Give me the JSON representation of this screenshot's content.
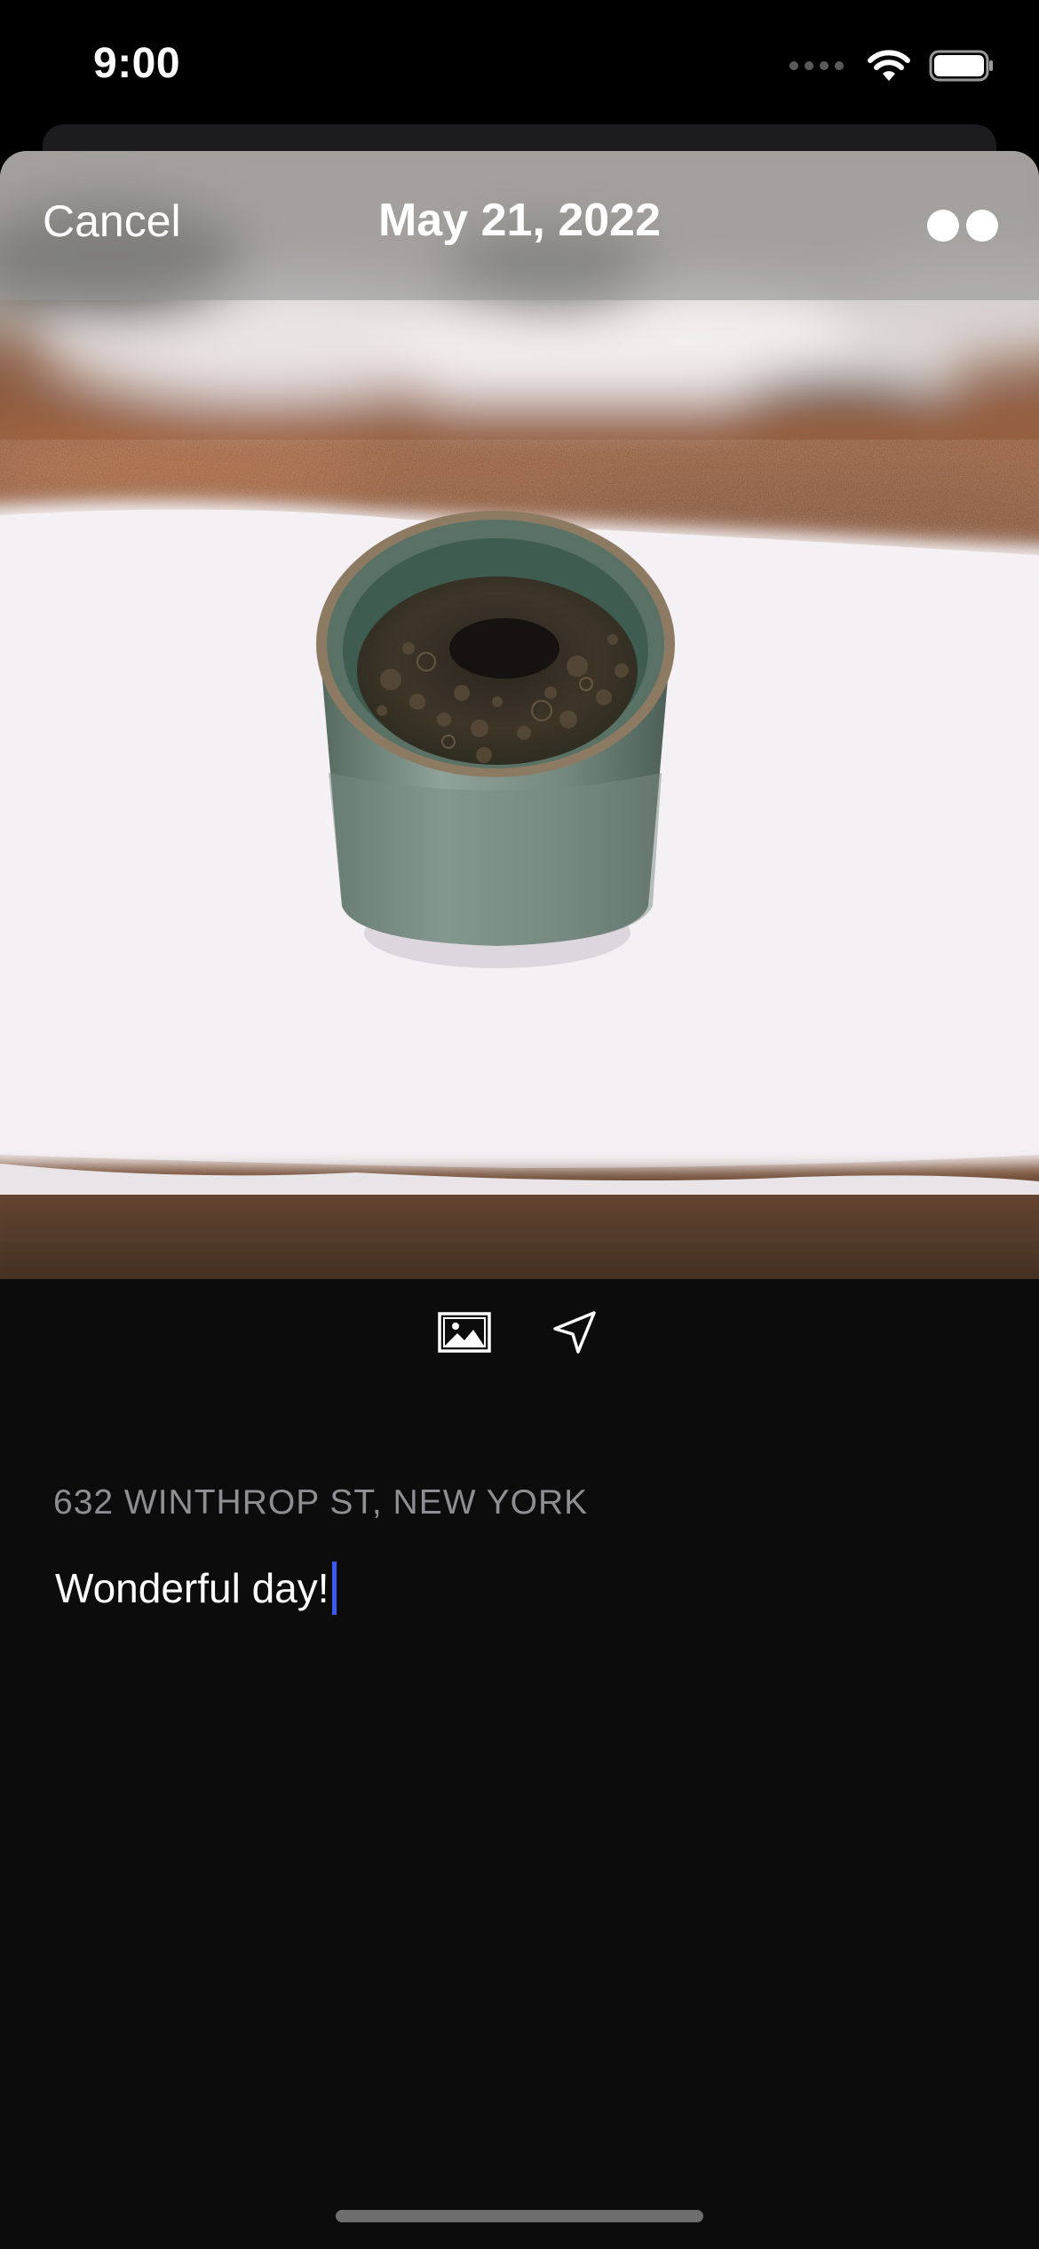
{
  "status_bar": {
    "time": "9:00"
  },
  "nav": {
    "cancel_label": "Cancel",
    "title": "May 21, 2022",
    "more_icon": "more-dots-icon"
  },
  "toolbar": {
    "photo_icon": "photo-icon",
    "location_icon": "location-arrow-icon"
  },
  "entry": {
    "location": "632 WINTHROP ST, NEW YORK",
    "text": "Wonderful day!"
  },
  "colors": {
    "background": "#0c0c0c",
    "caret": "#3b5bf5",
    "location_text": "#8e8e93"
  }
}
